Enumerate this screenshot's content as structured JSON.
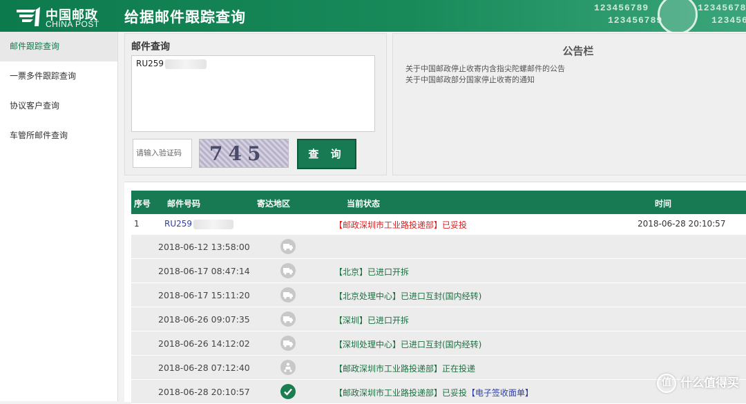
{
  "header": {
    "logo_cn": "中国邮政",
    "logo_en": "CHINA POST",
    "title": "给据邮件跟踪查询",
    "deco_numbers": [
      "123456789",
      "123456789",
      "123456789",
      "123456"
    ]
  },
  "sidebar": {
    "items": [
      {
        "label": "邮件跟踪查询",
        "active": true
      },
      {
        "label": "一票多件跟踪查询",
        "active": false
      },
      {
        "label": "协议客户查询",
        "active": false
      },
      {
        "label": "车管所邮件查询",
        "active": false
      }
    ]
  },
  "query": {
    "title": "邮件查询",
    "tracking_value": "RU259",
    "captcha_placeholder": "请输入验证码",
    "captcha_text": "745",
    "button_label": "查 询"
  },
  "notice": {
    "title": "公告栏",
    "items": [
      "关于中国邮政停止收寄内含指尖陀螺邮件的公告",
      "关于中国邮政部分国家停止收寄的通知"
    ]
  },
  "results": {
    "headers": {
      "index": "序号",
      "number": "邮件号码",
      "region": "寄达地区",
      "status": "当前状态",
      "time": "时间"
    },
    "main": {
      "index": "1",
      "number": "RU259",
      "status": "【邮政深圳市工业路投递部】已妥投",
      "time": "2018-06-28 20:10:57"
    },
    "events": [
      {
        "time": "2018-06-12 13:58:00",
        "status": "",
        "icon": "truck-icon"
      },
      {
        "time": "2018-06-17 08:47:14",
        "status": "【北京】已进口开拆",
        "icon": "truck-icon"
      },
      {
        "time": "2018-06-17 15:11:20",
        "status": "【北京处理中心】已进口互封(国内经转)",
        "icon": "truck-icon"
      },
      {
        "time": "2018-06-26 09:07:35",
        "status": "【深圳】已进口开拆",
        "icon": "truck-icon"
      },
      {
        "time": "2018-06-26 14:12:02",
        "status": "【深圳处理中心】已进口互封(国内经转)",
        "icon": "truck-icon"
      },
      {
        "time": "2018-06-28 07:12:40",
        "status": "【邮政深圳市工业路投递部】正在投递",
        "icon": "courier-icon"
      },
      {
        "time": "2018-06-28 20:10:57",
        "status": "【邮政深圳市工业路投递部】已妥投",
        "icon": "checkmark-icon",
        "extra": "【电子签收面单】"
      }
    ]
  },
  "watermark": {
    "text": "什么值得买",
    "icon_glyph": "值"
  },
  "colors": {
    "brand_green": "#187a52",
    "status_red": "#d42020",
    "link_blue": "#2c3ea8"
  }
}
